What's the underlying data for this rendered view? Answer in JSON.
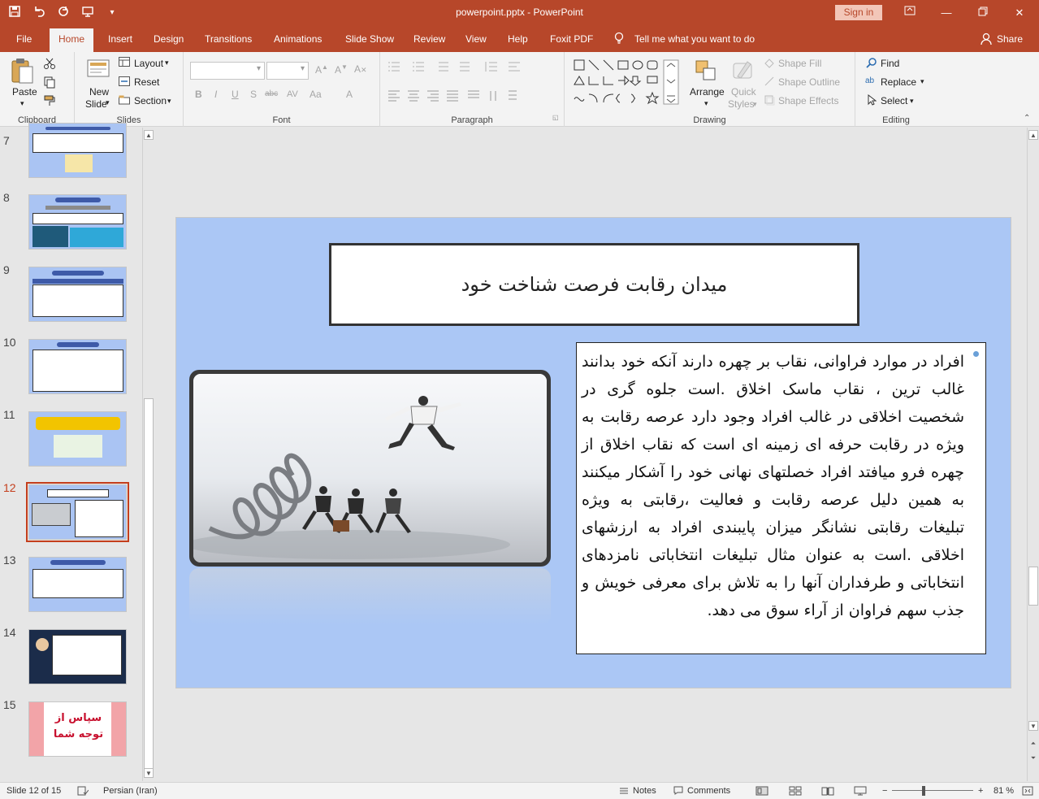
{
  "window": {
    "title": "powerpoint.pptx  -  PowerPoint",
    "signin": "Sign in",
    "qat_icons": [
      "save-icon",
      "undo-icon",
      "redo-icon",
      "start-from-beginning-icon",
      "customize-qat-icon"
    ],
    "colors": {
      "accent": "#b7472a",
      "ribbon_bg": "#f3f3f3",
      "slide_bg": "#abc7f5",
      "selected_thumb": "#c43e1c"
    }
  },
  "tabs": {
    "file": "File",
    "home": "Home",
    "insert": "Insert",
    "design": "Design",
    "transitions": "Transitions",
    "animations": "Animations",
    "slideshow": "Slide Show",
    "review": "Review",
    "view": "View",
    "help": "Help",
    "foxit": "Foxit PDF",
    "tell": "Tell me what you want to do",
    "share": "Share"
  },
  "ribbon": {
    "clipboard": {
      "label": "Clipboard",
      "paste": "Paste"
    },
    "slides": {
      "label": "Slides",
      "new_slide_1": "New",
      "new_slide_2": "Slide",
      "layout": "Layout",
      "reset": "Reset",
      "section": "Section"
    },
    "font": {
      "label": "Font",
      "bold": "B",
      "italic": "I",
      "underline": "U",
      "shadow": "S",
      "strike": "abc",
      "spacing": "AV",
      "case": "Aa",
      "color": "A"
    },
    "paragraph": {
      "label": "Paragraph"
    },
    "drawing": {
      "label": "Drawing",
      "arrange": "Arrange",
      "quick_1": "Quick",
      "quick_2": "Styles",
      "shape_fill": "Shape Fill",
      "shape_outline": "Shape Outline",
      "shape_effects": "Shape Effects"
    },
    "editing": {
      "label": "Editing",
      "find": "Find",
      "replace": "Replace",
      "select": "Select"
    }
  },
  "thumbnails": [
    {
      "num": "7"
    },
    {
      "num": "8"
    },
    {
      "num": "9"
    },
    {
      "num": "10"
    },
    {
      "num": "11"
    },
    {
      "num": "12"
    },
    {
      "num": "13"
    },
    {
      "num": "14"
    },
    {
      "num": "15",
      "text_1": "سپاس از",
      "text_2": "توجه شما"
    }
  ],
  "slide": {
    "title": "میدان رقابت فرصت شناخت خود",
    "body": "افراد در موارد فراوانی، نقاب بر چهره دارند آنکه خود بدانند غالب ترین ، نقاب ماسک اخلاق .است جلوه گری در شخصیت اخلاقی در غالب افراد وجود دارد عرصه رقابت به ویژه در رقابت حرفه ای زمینه ای است که نقاب اخلاق از چهره فرو میافتد افراد خصلتهای نهانی خود را آشکار میکنند به همین دلیل عرصه رقابت و فعالیت ،رقابتی به ویژه تبلیغات رقابتی نشانگر میزان پایبندی افراد به ارزشهای اخلاقی .است به عنوان مثال تبلیغات انتخاباتی نامزدهای انتخاباتی و طرفداران آنها را به تلاش برای معرفی خویش و جذب سهم فراوان از آراء سوق می دهد."
  },
  "status": {
    "slide_info": "Slide 12 of 15",
    "language": "Persian (Iran)",
    "notes": "Notes",
    "comments": "Comments",
    "zoom": "81 %"
  }
}
